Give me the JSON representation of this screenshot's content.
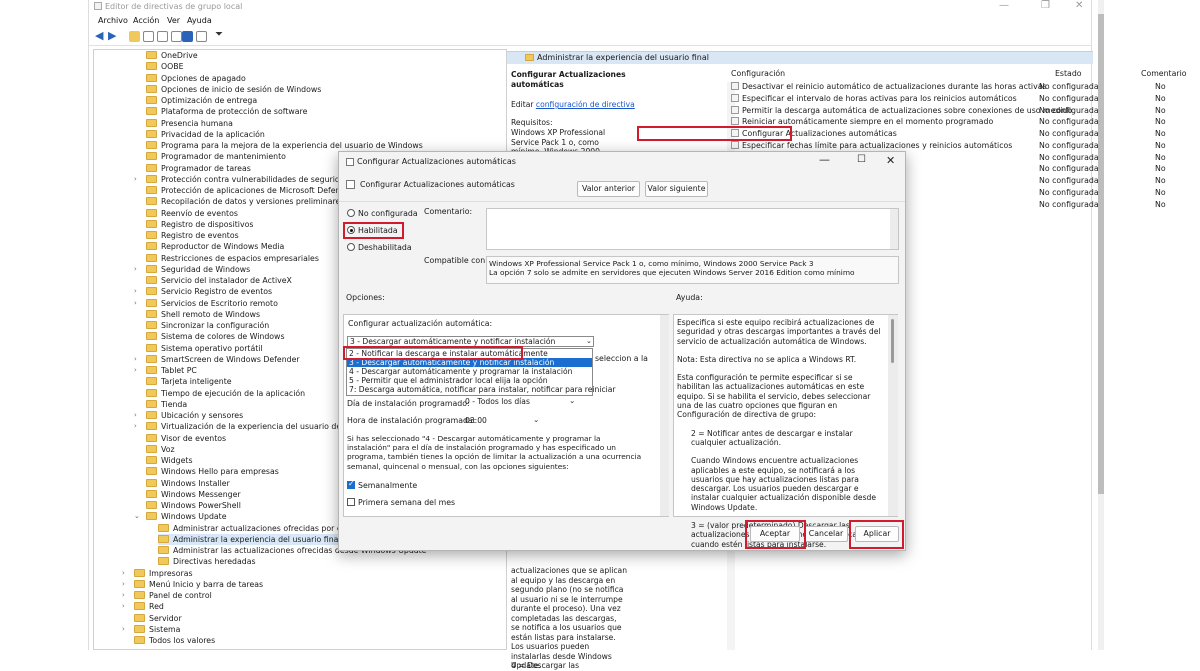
{
  "window": {
    "title": "Editor de directivas de grupo local"
  },
  "menu": [
    "Archivo",
    "Acción",
    "Ver",
    "Ayuda"
  ],
  "tree": [
    {
      "label": "OneDrive"
    },
    {
      "label": "OOBE"
    },
    {
      "label": "Opciones de apagado"
    },
    {
      "label": "Opciones de inicio de sesión de Windows"
    },
    {
      "label": "Optimización de entrega"
    },
    {
      "label": "Plataforma de protección de software"
    },
    {
      "label": "Presencia humana"
    },
    {
      "label": "Privacidad de la aplicación"
    },
    {
      "label": "Programa para la mejora de la experiencia del usuario de Windows"
    },
    {
      "label": "Programador de mantenimiento"
    },
    {
      "label": "Programador de tareas"
    },
    {
      "label": "Protección contra vulnerabilidades de seguridad de Mic",
      "arrow": true
    },
    {
      "label": "Protección de aplicaciones de Microsoft Defender"
    },
    {
      "label": "Recopilación de datos y versiones preliminares"
    },
    {
      "label": "Reenvío de eventos"
    },
    {
      "label": "Registro de dispositivos"
    },
    {
      "label": "Registro de eventos"
    },
    {
      "label": "Reproductor de Windows Media"
    },
    {
      "label": "Restricciones de espacios empresariales"
    },
    {
      "label": "Seguridad de Windows",
      "arrow": true
    },
    {
      "label": "Servicio del instalador de ActiveX"
    },
    {
      "label": "Servicio Registro de eventos",
      "arrow": true
    },
    {
      "label": "Servicios de Escritorio remoto",
      "arrow": true
    },
    {
      "label": "Shell remoto de Windows"
    },
    {
      "label": "Sincronizar la configuración"
    },
    {
      "label": "Sistema de colores de Windows"
    },
    {
      "label": "Sistema operativo portátil"
    },
    {
      "label": "SmartScreen de Windows Defender",
      "arrow": true
    },
    {
      "label": "Tablet PC",
      "arrow": true
    },
    {
      "label": "Tarjeta inteligente"
    },
    {
      "label": "Tiempo de ejecución de la aplicación"
    },
    {
      "label": "Tienda"
    },
    {
      "label": "Ubicación y sensores",
      "arrow": true
    },
    {
      "label": "Virtualización de la experiencia del usuario de Microsoft",
      "arrow": true
    },
    {
      "label": "Visor de eventos"
    },
    {
      "label": "Voz"
    },
    {
      "label": "Widgets"
    },
    {
      "label": "Windows Hello para empresas"
    },
    {
      "label": "Windows Installer"
    },
    {
      "label": "Windows Messenger"
    },
    {
      "label": "Windows PowerShell"
    },
    {
      "label": "Windows Update",
      "arrow": true,
      "expanded": true
    }
  ],
  "tree_sub": [
    {
      "label": "Administrar actualizaciones ofrecidas por el servicio"
    },
    {
      "label": "Administrar la experiencia del usuario final"
    },
    {
      "label": "Administrar las actualizaciones ofrecidas desde Windows Update"
    },
    {
      "label": "Directivas heredadas"
    }
  ],
  "tree_root": [
    {
      "label": "Impresoras",
      "arrow": true
    },
    {
      "label": "Menú Inicio y barra de tareas",
      "arrow": true
    },
    {
      "label": "Panel de control",
      "arrow": true
    },
    {
      "label": "Red",
      "arrow": true
    },
    {
      "label": "Servidor"
    },
    {
      "label": "Sistema",
      "arrow": true
    },
    {
      "label": "Todos los valores"
    }
  ],
  "right": {
    "header": "Administrar la experiencia del usuario final",
    "desc_title": "Configurar Actualizaciones automáticas",
    "edit_prefix": "Editar",
    "edit_link": "configuración de directiva",
    "req_label": "Requisitos:",
    "req_text": "Windows XP Professional Service Pack 1 o, como mínimo, Windows 2000 Service Pack 3 La opción 7",
    "desc_bottom": "actualizaciones que se aplican al equipo y las descarga en segundo plano (no se notifica al usuario ni se le interrumpe durante el proceso). Una vez completadas las descargas, se notifica a los usuarios que están listas para instalarse. Los usuarios pueden instalarlas desde Windows Update.",
    "desc_more": "4 = Descargar las",
    "col_config": "Configuración",
    "col_state": "Estado",
    "col_comment": "Comentario",
    "rows": [
      {
        "name": "Desactivar el reinicio automático de actualizaciones durante las horas activas",
        "state": "No configurada",
        "comment": "No"
      },
      {
        "name": "Especificar el intervalo de horas activas para los reinicios automáticos",
        "state": "No configurada",
        "comment": "No"
      },
      {
        "name": "Permitir la descarga automática de actualizaciones sobre conexiones de uso medido",
        "state": "No configurada",
        "comment": "No"
      },
      {
        "name": "Reiniciar automáticamente siempre en el momento programado",
        "state": "No configurada",
        "comment": "No"
      },
      {
        "name": "Configurar Actualizaciones automáticas",
        "state": "No configurada",
        "comment": "No"
      },
      {
        "name": "Especificar fechas límite para actualizaciones y reinicios automáticos",
        "state": "No configurada",
        "comment": "No"
      },
      {
        "name": "",
        "state": "No configurada",
        "comment": "No"
      },
      {
        "name": "",
        "state": "No configurada",
        "comment": "No"
      },
      {
        "name": "",
        "state": "No configurada",
        "comment": "No"
      },
      {
        "name": "",
        "state": "No configurada",
        "comment": "No"
      },
      {
        "name": "",
        "state": "No configurada",
        "comment": "No"
      }
    ]
  },
  "dialog": {
    "title": "Configurar Actualizaciones automáticas",
    "subtitle": "Configurar Actualizaciones automáticas",
    "prev": "Valor anterior",
    "next": "Valor siguiente",
    "r_not": "No configurada",
    "r_on": "Habilitada",
    "r_off": "Deshabilitada",
    "comment_label": "Comentario:",
    "compat_label": "Compatible con:",
    "compat_text1": "Windows XP Professional Service Pack 1 o, como mínimo, Windows 2000 Service Pack 3",
    "compat_text2": "La opción 7 solo se admite en servidores que ejecuten Windows Server 2016 Edition como mínimo",
    "options_label": "Opciones:",
    "help_label": "Ayuda:",
    "opt_title": "Configurar actualización automática:",
    "dd_value": "3 - Descargar automáticamente y notificar instalación",
    "dd_items": [
      "2 - Notificar la descarga e instalar automáticamente",
      "3 - Descargar automáticamente y notificar instalación",
      "4 - Descargar automáticamente y programar la instalación",
      "5 - Permitir que el administrador local elija la opción",
      "7: Descarga automática, notificar para instalar, notificar para reiniciar"
    ],
    "behind_text": "seleccion a la",
    "day_label": "Día de instalación programado:",
    "day_value": "0 - Todos los días",
    "hour_label": "Hora de instalación programada:",
    "hour_value": "03:00",
    "info": "Si has seleccionado \"4 - Descargar automáticamente y programar la instalación\" para el día de instalación programado y has especificado un programa, también tienes la opción de limitar la actualización a una ocurrencia semanal, quincenal o mensual, con las opciones siguientes:",
    "weekly": "Semanalmente",
    "firstweek": "Primera semana del mes",
    "help": [
      "Especifica si este equipo recibirá actualizaciones de seguridad y otras descargas importantes a través del servicio de actualización automática de Windows.",
      "Nota: Esta directiva no se aplica a Windows RT.",
      "Esta configuración te permite especificar si se habilitan las actualizaciones automáticas en este equipo. Si se habilita el servicio, debes seleccionar una de las cuatro opciones que figuran en Configuración de directiva de grupo:",
      "2 = Notificar antes de descargar e instalar cualquier actualización.",
      "Cuando Windows encuentre actualizaciones aplicables a este equipo, se notificará a los usuarios que hay actualizaciones listas para descargar. Los usuarios pueden descargar e instalar cualquier actualización disponible desde Windows Update.",
      "3 = (valor predeterminado) Descargar las actualizaciones automáticamente y notificar cuando estén listas para instalarse."
    ],
    "ok": "Aceptar",
    "cancel": "Cancelar",
    "apply": "Aplicar"
  },
  "colors": {
    "highlight": "#d01c2c",
    "selection": "#1a6ecf",
    "header": "#d9e6f3"
  }
}
